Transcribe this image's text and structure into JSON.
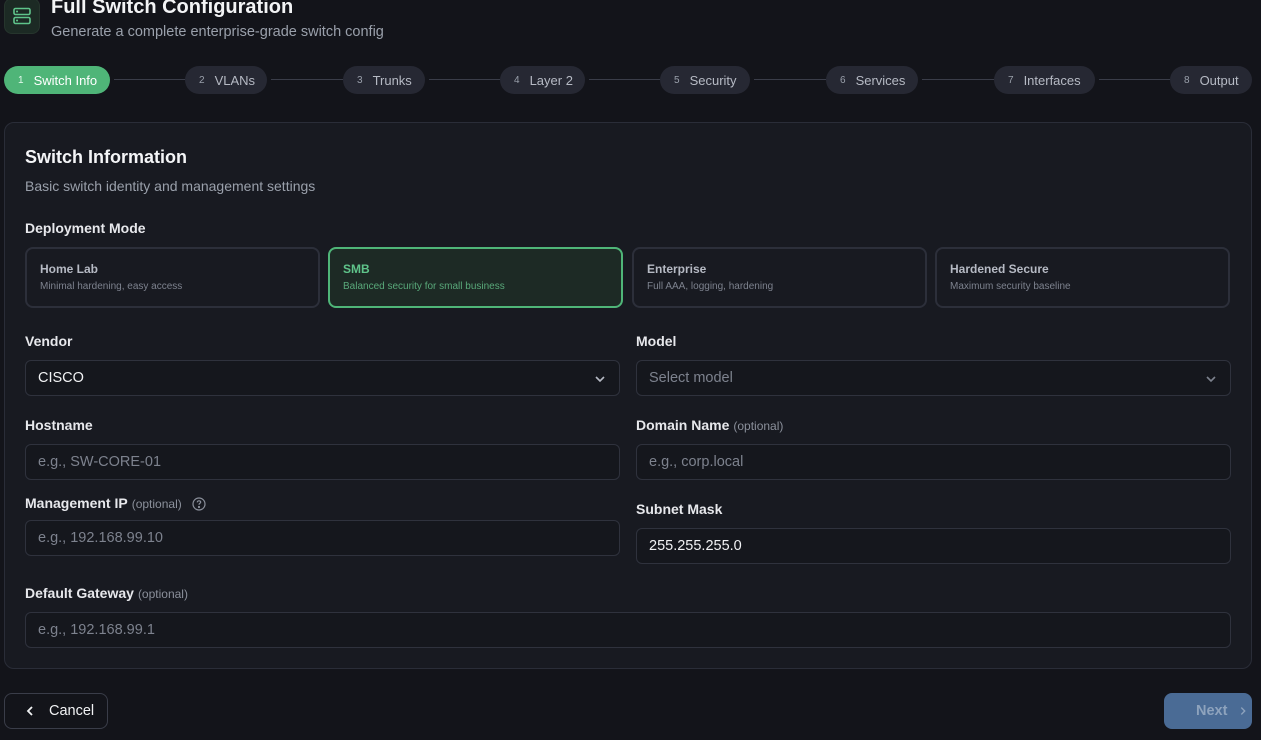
{
  "header": {
    "icon": "server-icon",
    "title": "Full Switch Configuration",
    "subtitle": "Generate a complete enterprise-grade switch config"
  },
  "steps": [
    {
      "num": "1",
      "label": "Switch Info",
      "active": true
    },
    {
      "num": "2",
      "label": "VLANs"
    },
    {
      "num": "3",
      "label": "Trunks"
    },
    {
      "num": "4",
      "label": "Layer 2"
    },
    {
      "num": "5",
      "label": "Security"
    },
    {
      "num": "6",
      "label": "Services"
    },
    {
      "num": "7",
      "label": "Interfaces"
    },
    {
      "num": "8",
      "label": "Output"
    }
  ],
  "card": {
    "title": "Switch Information",
    "description": "Basic switch identity and management settings"
  },
  "deployment": {
    "label": "Deployment Mode",
    "modes": [
      {
        "title": "Home Lab",
        "desc": "Minimal hardening, easy access"
      },
      {
        "title": "SMB",
        "desc": "Balanced security for small business",
        "selected": true
      },
      {
        "title": "Enterprise",
        "desc": "Full AAA, logging, hardening"
      },
      {
        "title": "Hardened Secure",
        "desc": "Maximum security baseline"
      }
    ]
  },
  "form": {
    "vendor": {
      "label": "Vendor",
      "value": "CISCO"
    },
    "model": {
      "label": "Model",
      "placeholder": "Select model"
    },
    "hostname": {
      "label": "Hostname",
      "placeholder": "e.g., SW-CORE-01"
    },
    "domain": {
      "label": "Domain Name",
      "optional": "(optional)",
      "placeholder": "e.g., corp.local"
    },
    "mgmt_ip": {
      "label": "Management IP",
      "optional": "(optional)",
      "placeholder": "e.g., 192.168.99.10"
    },
    "subnet": {
      "label": "Subnet Mask",
      "value": "255.255.255.0"
    },
    "gateway": {
      "label": "Default Gateway",
      "optional": "(optional)",
      "placeholder": "e.g., 192.168.99.1"
    }
  },
  "footer": {
    "cancel_label": "Cancel",
    "next_label": "Next"
  },
  "colors": {
    "accent": "#4fb578",
    "background": "#13141a",
    "card": "#181a21",
    "next_button": "#4a6b95"
  }
}
